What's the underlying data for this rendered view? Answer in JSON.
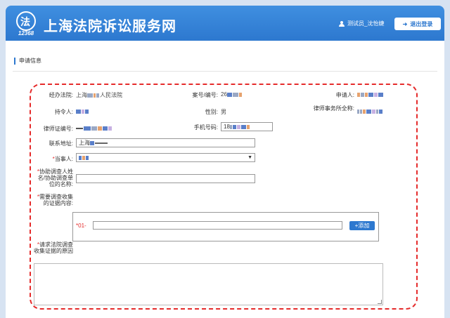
{
  "header": {
    "logo_glyph": "法",
    "logo_number": "12368",
    "title": "上海法院诉讼服务网",
    "user_name": "测试员_沈怡婕",
    "logout_label": "退出登录"
  },
  "section": {
    "title": "申请信息"
  },
  "form": {
    "court_label": "经办法院:",
    "court_value_prefix": "上海",
    "court_value_suffix": "人民法院",
    "case_label": "案号/编号:",
    "case_value_prefix": "26",
    "applicant_label": "申请人:",
    "holder_label": "持令人:",
    "gender_label": "性别:",
    "gender_value": "男",
    "firm_label": "律师事务所全称:",
    "license_label": "律师证编号:",
    "phone_label": "手机号码:",
    "phone_value_prefix": "18",
    "address_label": "联系地址:",
    "address_value": "上海",
    "party_label": "当事人:",
    "assist_label": "协助调查人姓名/协助调查单位的名称:",
    "evidence_label": "需要调查收集的证据内容:",
    "evidence_prefix": "*01-",
    "add_label": "+添加",
    "reason_label": "请求法院调查收集证据的原因"
  },
  "colors": {
    "header_blue": "#2d78cf",
    "dashed_red": "#e52b2b"
  }
}
